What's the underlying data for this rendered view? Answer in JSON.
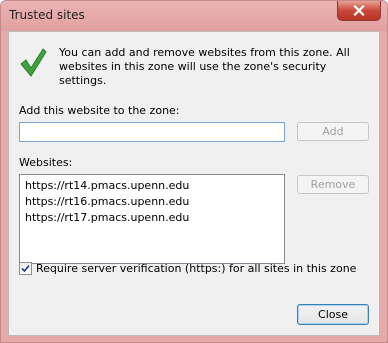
{
  "window": {
    "title": "Trusted sites"
  },
  "info": {
    "message": "You can add and remove websites from this zone. All websites in this zone will use the zone's security settings."
  },
  "add": {
    "label": "Add this website to the zone:",
    "value": "",
    "button": "Add"
  },
  "websites": {
    "label": "Websites:",
    "items": [
      {
        "url": "https://rt14.pmacs.upenn.edu"
      },
      {
        "url": "https://rt16.pmacs.upenn.edu"
      },
      {
        "url": "https://rt17.pmacs.upenn.edu"
      }
    ],
    "remove_button": "Remove"
  },
  "verification": {
    "label": "Require server verification (https:) for all sites in this zone",
    "checked": true
  },
  "footer": {
    "close_button": "Close"
  },
  "colors": {
    "titlebar": "#e29f9f",
    "close_button": "#c8493b",
    "check_icon": "#3fa33d"
  },
  "icons": {
    "check": "check-icon",
    "close": "close-icon"
  }
}
